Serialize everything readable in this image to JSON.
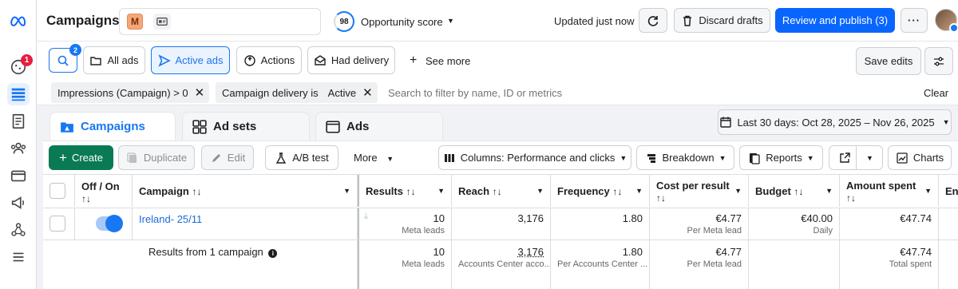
{
  "rail": {
    "notification_count": "1"
  },
  "header": {
    "title": "Campaigns",
    "account_initial": "M",
    "opportunity_score": "98",
    "opportunity_label": "Opportunity score",
    "updated_text": "Updated just now",
    "discard_label": "Discard drafts",
    "review_label": "Review and publish (3)"
  },
  "filters": {
    "search_badge": "2",
    "all_ads": "All ads",
    "active_ads": "Active ads",
    "actions": "Actions",
    "had_delivery": "Had delivery",
    "see_more": "See more",
    "save_edits": "Save edits",
    "chip1": "Impressions (Campaign) > 0",
    "chip2_prefix": "Campaign delivery is",
    "chip2_value": "Active",
    "search_placeholder": "Search to filter by name, ID or metrics",
    "clear": "Clear"
  },
  "tabs": [
    "Campaigns",
    "Ad sets",
    "Ads"
  ],
  "date_range": "Last 30 days: Oct 28, 2025 – Nov 26, 2025",
  "toolbar": {
    "create": "Create",
    "duplicate": "Duplicate",
    "edit": "Edit",
    "ab_test": "A/B test",
    "more": "More",
    "columns": "Columns: Performance and clicks",
    "breakdown": "Breakdown",
    "reports": "Reports",
    "charts": "Charts"
  },
  "table": {
    "headers": {
      "offon": "Off / On",
      "campaign": "Campaign",
      "results": "Results",
      "reach": "Reach",
      "frequency": "Frequency",
      "cost": "Cost per result",
      "budget": "Budget",
      "amount": "Amount spent",
      "ends": "Ends"
    },
    "row": {
      "campaign": "Ireland- 25/11",
      "results": "10",
      "results_sub": "Meta leads",
      "reach": "3,176",
      "frequency": "1.80",
      "cost": "€4.77",
      "cost_sub": "Per Meta lead",
      "budget": "€40.00",
      "budget_sub": "Daily",
      "amount": "€47.74"
    },
    "summary": {
      "label": "Results from 1 campaign",
      "results": "10",
      "results_sub": "Meta leads",
      "reach": "3,176",
      "reach_sub": "Accounts Center acco...",
      "frequency": "1.80",
      "frequency_sub": "Per Accounts Center ...",
      "cost": "€4.77",
      "cost_sub": "Per Meta lead",
      "amount": "€47.74",
      "amount_sub": "Total spent"
    }
  }
}
